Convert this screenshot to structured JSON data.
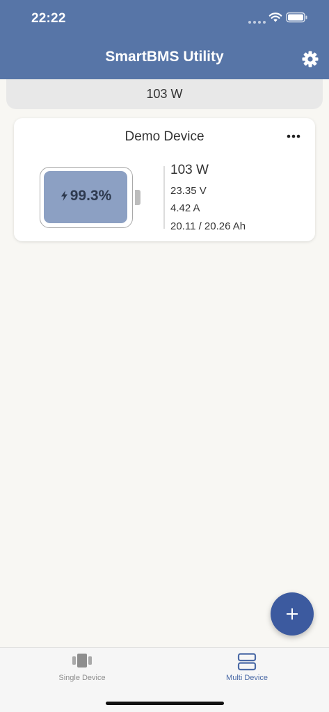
{
  "status_bar": {
    "time": "22:22"
  },
  "header": {
    "title": "SmartBMS Utility",
    "settings_icon": "gear-icon"
  },
  "summary": {
    "total_power": "103 W"
  },
  "devices": [
    {
      "name": "Demo Device",
      "menu_icon": "ellipsis-icon",
      "charge_level": "99.3%",
      "charge_fraction": 0.993,
      "charging_icon": "bolt-icon",
      "power": "103 W",
      "voltage": "23.35 V",
      "current": "4.42 A",
      "capacity": "20.11 / 20.26 Ah"
    }
  ],
  "fab": {
    "icon": "plus-icon"
  },
  "tabs": [
    {
      "label": "Single Device",
      "icon": "single-device-icon",
      "selected": false
    },
    {
      "label": "Multi Device",
      "icon": "multi-device-icon",
      "selected": true
    }
  ],
  "colors": {
    "header": "#5775a7",
    "accent": "#3c5a9f",
    "battery_fill": "#8ca0c3",
    "tab_active": "#4b6aa6",
    "tab_inactive": "#8e8e8e",
    "background": "#f8f7f3"
  }
}
